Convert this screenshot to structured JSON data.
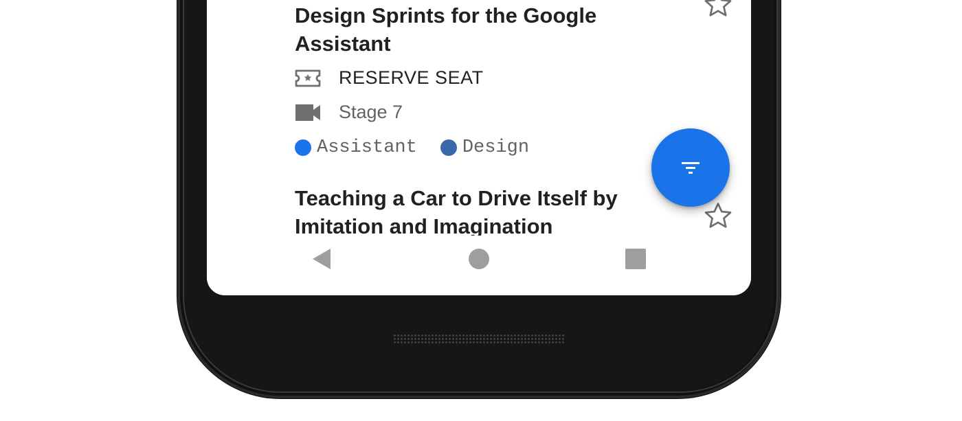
{
  "colors": {
    "accent": "#1a73e8",
    "tag_assistant": "#1a73e8",
    "tag_design": "#3b69a8",
    "icon_gray": "#707070",
    "nav_gray": "#9e9e9e"
  },
  "sessions": [
    {
      "title": "Design Sprints for the Google Assistant",
      "reserve_label": "RESERVE SEAT",
      "reserve_icon": "ticket-icon",
      "room": "Stage 7",
      "room_icon": "videocam-icon",
      "tags": [
        {
          "label": "Assistant"
        },
        {
          "label": "Design"
        }
      ],
      "star_icon": "star-outline-icon"
    },
    {
      "title": "Teaching a Car to Drive Itself by Imitation and Imagination",
      "star_icon": "star-outline-icon"
    }
  ],
  "fab": {
    "icon": "filter-icon"
  },
  "nav": {
    "back_icon": "back-triangle-icon",
    "home_icon": "home-circle-icon",
    "recents_icon": "recents-square-icon"
  }
}
